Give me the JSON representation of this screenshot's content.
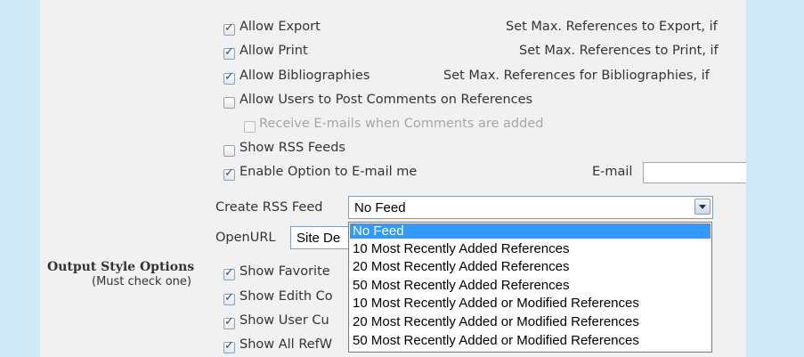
{
  "options": {
    "allow_export": {
      "label": "Allow Export",
      "checked": true
    },
    "allow_print": {
      "label": "Allow Print",
      "checked": true
    },
    "allow_bibliographies": {
      "label": "Allow Bibliographies",
      "checked": true
    },
    "allow_comments": {
      "label": "Allow Users to Post Comments on References",
      "checked": false
    },
    "receive_emails": {
      "label": "Receive E-mails when Comments are added",
      "checked": false,
      "disabled": true
    },
    "show_rss": {
      "label": "Show RSS Feeds",
      "checked": false
    },
    "enable_email": {
      "label": "Enable Option to E-mail me",
      "checked": true
    }
  },
  "max_refs": {
    "export": "Set Max. References to Export, if",
    "print": "Set Max. References to Print, if",
    "bibliographies": "Set Max. References for Bibliographies, if"
  },
  "email": {
    "label": "E-mail",
    "value": ""
  },
  "rss_feed": {
    "label": "Create RSS Feed",
    "selected": "No Feed",
    "options": [
      "No Feed",
      "10 Most Recently Added References",
      "20 Most Recently Added References",
      "50 Most Recently Added References",
      "10 Most Recently Added or Modified References",
      "20 Most Recently Added or Modified References",
      "50 Most Recently Added or Modified References"
    ]
  },
  "openurl": {
    "label": "OpenURL",
    "value": "Site De"
  },
  "output_style": {
    "title": "Output Style Options",
    "subtitle": "(Must check one)",
    "items": [
      {
        "label": "Show Favorite",
        "checked": true
      },
      {
        "label": "Show Edith Co",
        "checked": true
      },
      {
        "label": "Show User Cu",
        "checked": true
      },
      {
        "label": "Show All RefW",
        "checked": true
      }
    ]
  }
}
